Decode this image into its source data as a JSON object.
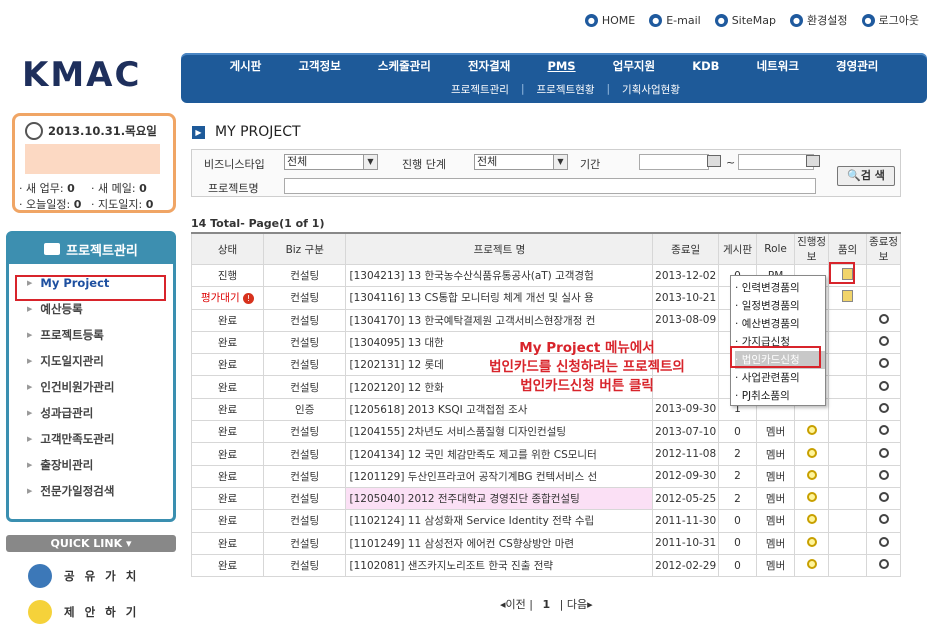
{
  "topmenu": [
    {
      "icon": "home-icon",
      "label": "HOME"
    },
    {
      "icon": "mail-icon",
      "label": "E-mail"
    },
    {
      "icon": "sitemap-icon",
      "label": "SiteMap"
    },
    {
      "icon": "settings-icon",
      "label": "환경설정"
    },
    {
      "icon": "logout-icon",
      "label": "로그아웃"
    }
  ],
  "logo": "KMAC",
  "gnb": {
    "items": [
      "게시판",
      "고객정보",
      "스케줄관리",
      "전자결재",
      "PMS",
      "업무지원",
      "KDB",
      "네트워크",
      "경영관리"
    ],
    "active": "PMS",
    "sub": [
      "프로젝트관리",
      "프로젝트현황",
      "기획사업현황"
    ]
  },
  "datebox": {
    "date": "2013.10.31.목요일",
    "new_task_label": "새 업무:",
    "new_task": "0",
    "new_mail_label": "새 메일:",
    "new_mail": "0",
    "today_label": "오늘일정:",
    "today": "0",
    "guide_label": "지도일지:",
    "guide": "0"
  },
  "sidebar": {
    "title": "프로젝트관리",
    "items": [
      "My Project",
      "예산등록",
      "프로젝트등록",
      "지도일지관리",
      "인건비원가관리",
      "성과급관리",
      "고객만족도관리",
      "출장비관리",
      "전문가일정검색"
    ]
  },
  "quick": {
    "title": "QUICK LINK",
    "items": [
      "공유가치",
      "제안하기"
    ]
  },
  "page_title": "MY PROJECT",
  "search": {
    "biz_label": "비즈니스타입",
    "biz_value": "전체",
    "stage_label": "진행 단계",
    "stage_value": "전체",
    "period_label": "기간",
    "tilde": "~",
    "name_label": "프로젝트명",
    "button": "검 색"
  },
  "total": "14 Total- Page(1 of 1)",
  "table": {
    "headers": [
      "상태",
      "Biz 구분",
      "프로젝트 명",
      "종료일",
      "게시판",
      "Role",
      "진행정보",
      "품의",
      "종료정보"
    ],
    "rows": [
      [
        "진행",
        "컨설팅",
        "[1304213] 13 한국농수산식품유통공사(aT) 고객경험",
        "2013-12-02",
        "0",
        "PM",
        "",
        "doc",
        ""
      ],
      [
        "평가대기",
        "컨설팅",
        "[1304116] 13 CS통합 모니터링 체계 개선 및 실사 용",
        "2013-10-21",
        "0",
        "",
        "",
        "doc",
        ""
      ],
      [
        "완료",
        "컨설팅",
        "[1304170] 13 한국예탁결제원 고객서비스현장개정 컨",
        "2013-08-09",
        "0",
        "",
        "",
        "",
        "mag"
      ],
      [
        "완료",
        "컨설팅",
        "[1304095] 13 대한",
        "",
        "",
        "",
        "",
        "",
        "mag"
      ],
      [
        "완료",
        "컨설팅",
        "[1202131] 12 롯데",
        "",
        "",
        "",
        "",
        "",
        "mag"
      ],
      [
        "완료",
        "컨설팅",
        "[1202120] 12 한화",
        "",
        "",
        "",
        "",
        "",
        "mag"
      ],
      [
        "완료",
        "인증",
        "[1205618] 2013 KSQI 고객접점 조사",
        "2013-09-30",
        "1",
        "",
        "",
        "",
        "mag"
      ],
      [
        "완료",
        "컨설팅",
        "[1204155] 2차년도 서비스품질형 디자인컨설팅",
        "2013-07-10",
        "0",
        "멤버",
        "mag",
        "",
        "mag"
      ],
      [
        "완료",
        "컨설팅",
        "[1204134] 12 국민 체감만족도 제고를 위한 CS모니터",
        "2012-11-08",
        "2",
        "멤버",
        "mag",
        "",
        "mag"
      ],
      [
        "완료",
        "컨설팅",
        "[1201129] 두산인프라코어 공작기계BG 컨텍서비스 선",
        "2012-09-30",
        "2",
        "멤버",
        "mag",
        "",
        "mag"
      ],
      [
        "완료",
        "컨설팅",
        "[1205040] 2012 전주대학교 경영진단 종합컨설팅",
        "2012-05-25",
        "2",
        "멤버",
        "mag",
        "",
        "mag"
      ],
      [
        "완료",
        "컨설팅",
        "[1102124] 11 삼성화재 Service Identity 전략 수립",
        "2011-11-30",
        "0",
        "멤버",
        "mag",
        "",
        "mag"
      ],
      [
        "완료",
        "컨설팅",
        "[1101249] 11 삼성전자 에어컨 CS향상방안 마련",
        "2011-10-31",
        "0",
        "멤버",
        "mag",
        "",
        "mag"
      ],
      [
        "완료",
        "컨설팅",
        "[1102081] 샌즈카지노리조트 한국 진출 전략",
        "2012-02-29",
        "0",
        "멤버",
        "mag",
        "",
        "mag"
      ]
    ]
  },
  "popup": [
    "인력변경품의",
    "일정변경품의",
    "예산변경품의",
    "가지급신청",
    "법인카드신청",
    "사업관련품의",
    "PJ취소품의"
  ],
  "popup_active": "법인카드신청",
  "note": [
    "My Project 메뉴에서",
    "법인카드를 신청하려는 프로젝트의",
    "법인카드신청 버튼 클릭"
  ],
  "paging": {
    "prev": "이전",
    "current": "1",
    "next": "다음"
  }
}
